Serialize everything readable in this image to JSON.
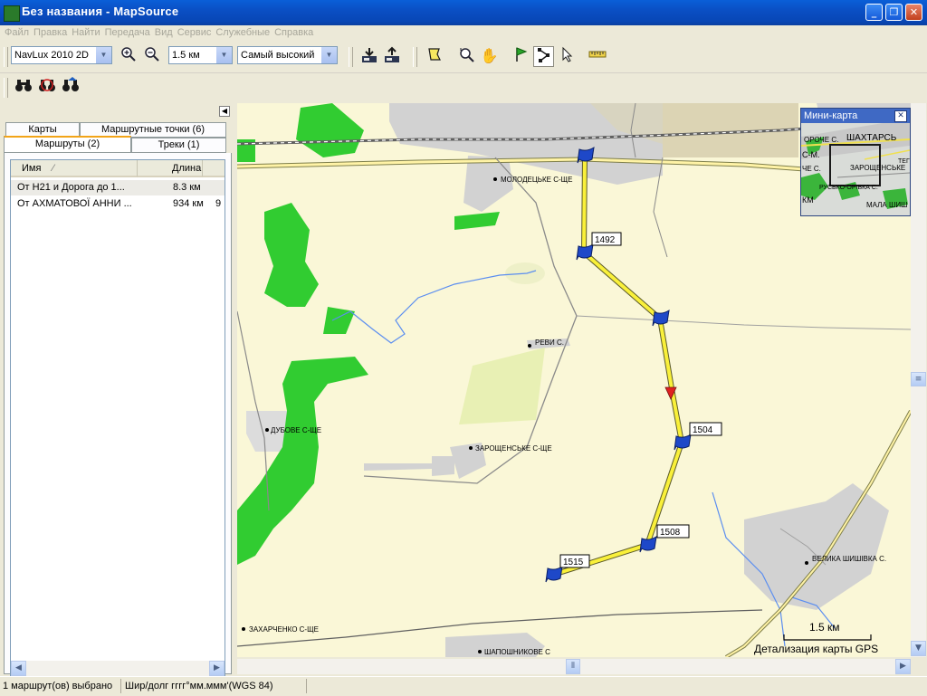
{
  "window": {
    "title": "Без названия - MapSource"
  },
  "menu": [
    "Файл",
    "Правка",
    "Найти",
    "Передача",
    "Вид",
    "Сервис",
    "Служебные",
    "Справка"
  ],
  "toolbar": {
    "map_product": "NavLux 2010 2D",
    "zoom_scale": "1.5 км",
    "detail_level": "Самый высокий"
  },
  "panel": {
    "tabs_top": [
      "Карты",
      "Маршрутные точки (6)"
    ],
    "tabs_bottom": [
      "Маршруты (2)",
      "Треки (1)"
    ],
    "active_tab": "Маршруты (2)",
    "columns": {
      "name": "Имя",
      "length": "Длина"
    },
    "rows": [
      {
        "name": "От  Н21 и Дорога до 1...",
        "length": "8.3 км",
        "extra": ""
      },
      {
        "name": "От  АХМАТОВОЇ АННИ ...",
        "length": "934 км",
        "extra": "9"
      }
    ]
  },
  "map": {
    "place_labels": [
      "МОЛОДЕЦЬКЕ С-ЩЕ",
      "РЕВИ С.",
      "ДУБОВЕ С-ЩЕ",
      "ЗАРОЩЕНСЬКЕ С-ЩЕ",
      "ВЕЛИКА ШИШІВКА С.",
      "ЗАХАРЧЕНКО С-ЩЕ",
      "ШАПОШНИКОВЕ С"
    ],
    "waypoints": [
      "1492",
      "1504",
      "1508",
      "1515"
    ],
    "scale_label": "1.5 км",
    "detail_label": "Детализация карты GPS"
  },
  "minimap": {
    "title": "Мини-карта",
    "labels": [
      "ОРОЧЕ С.",
      "ШАХТАРСЬ",
      "С-М.",
      "ЧЕ С.",
      "ЗАРОЩЕНСЬКЕ",
      "ТЕГ",
      "РУСЬКО-ОРІВКА С.",
      "КМ",
      "МАЛА ШИШ"
    ]
  },
  "status": {
    "selection": "1 маршрут(ов) выбрано",
    "coords_format": "Шир/долг гггг°мм.ммм'(WGS 84)"
  }
}
